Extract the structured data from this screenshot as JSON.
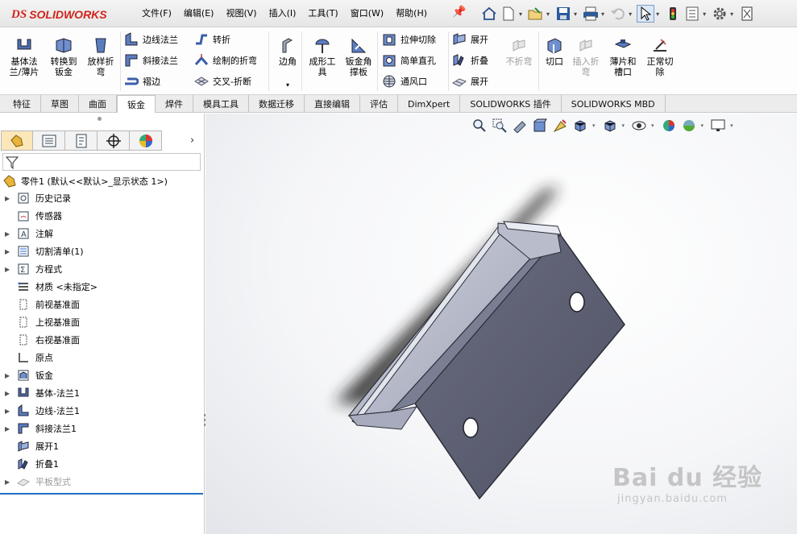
{
  "app": {
    "logo_ds": "DS",
    "logo_name": "SOLIDWORKS"
  },
  "menu": [
    "文件(F)",
    "编辑(E)",
    "视图(V)",
    "插入(I)",
    "工具(T)",
    "窗口(W)",
    "帮助(H)"
  ],
  "quick_access": [
    "home-icon",
    "new-document-icon",
    "open-icon",
    "save-icon",
    "print-icon",
    "undo-icon",
    "select-icon",
    "traffic-light-icon",
    "options-panel-icon",
    "gear-icon",
    "help-icon"
  ],
  "ribbon": {
    "base_flange": "基体法\n兰/薄片",
    "convert_to_sheet_metal": "转换到\n钣金",
    "lofted_bend": "放样折\n弯",
    "edge_flange": "边线法兰",
    "miter_flange": "斜接法兰",
    "hem": "褶边",
    "jog": "转折",
    "sketched_bend": "绘制的折弯",
    "cross_break": "交叉-折断",
    "corner": "边角",
    "forming_tool": "成形工\n具",
    "sheet_metal_gusset": "钣金角\n撑板",
    "extruded_cut": "拉伸切除",
    "simple_hole": "简单直孔",
    "vent": "通风口",
    "unfold": "展开",
    "fold": "折叠",
    "flatten": "展开",
    "no_bends": "不折弯",
    "rip": "切口",
    "insert_bends": "插入折\n弯",
    "tab_and_slot": "薄片和\n槽口",
    "normal_cut": "正常切\n除"
  },
  "tabs": [
    "特征",
    "草图",
    "曲面",
    "钣金",
    "焊件",
    "模具工具",
    "数据迁移",
    "直接编辑",
    "评估",
    "DimXpert",
    "SOLIDWORKS 插件",
    "SOLIDWORKS MBD"
  ],
  "active_tab": "钣金",
  "tree": {
    "root": "零件1  (默认<<默认>_显示状态 1>)",
    "items": [
      {
        "label": "历史记录",
        "icon": "history-icon",
        "expandable": true
      },
      {
        "label": "传感器",
        "icon": "sensor-icon",
        "expandable": false
      },
      {
        "label": "注解",
        "icon": "annotation-icon",
        "expandable": true
      },
      {
        "label": "切割清单(1)",
        "icon": "cut-list-icon",
        "expandable": true
      },
      {
        "label": "方程式",
        "icon": "equation-icon",
        "expandable": true
      },
      {
        "label": "材质 <未指定>",
        "icon": "material-icon",
        "expandable": false
      },
      {
        "label": "前视基准面",
        "icon": "plane-icon",
        "expandable": false
      },
      {
        "label": "上视基准面",
        "icon": "plane-icon",
        "expandable": false
      },
      {
        "label": "右视基准面",
        "icon": "plane-icon",
        "expandable": false
      },
      {
        "label": "原点",
        "icon": "origin-icon",
        "expandable": false
      },
      {
        "label": "钣金",
        "icon": "sheet-metal-icon",
        "expandable": true
      },
      {
        "label": "基体-法兰1",
        "icon": "base-flange-icon",
        "expandable": true
      },
      {
        "label": "边线-法兰1",
        "icon": "edge-flange-icon",
        "expandable": true
      },
      {
        "label": "斜接法兰1",
        "icon": "miter-flange-icon",
        "expandable": true
      },
      {
        "label": "展开1",
        "icon": "unfold-icon",
        "expandable": false
      },
      {
        "label": "折叠1",
        "icon": "fold-icon",
        "expandable": false
      },
      {
        "label": "平板型式",
        "icon": "flat-pattern-icon",
        "expandable": true,
        "suppressed": true
      }
    ]
  },
  "watermark": {
    "line1": "Bai du 经验",
    "line2": "jingyan.baidu.com"
  }
}
